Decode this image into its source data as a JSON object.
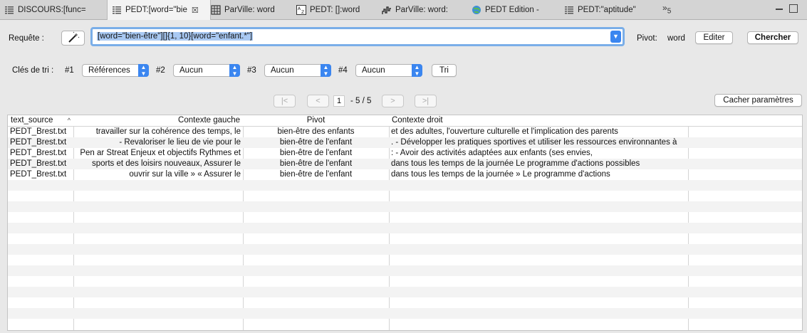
{
  "tabs": [
    {
      "label": "DISCOURS:[func=",
      "icon": "concordance-icon"
    },
    {
      "label": "PEDT:[word=\"bie",
      "icon": "concordance-icon",
      "active": true
    },
    {
      "label": "ParVille: word",
      "icon": "table-icon"
    },
    {
      "label": "PEDT: []:word",
      "icon": "lexicon-icon"
    },
    {
      "label": "ParVille: word:",
      "icon": "progression-chart-icon"
    },
    {
      "label": "PEDT Edition -",
      "icon": "globe-icon"
    },
    {
      "label": "PEDT:\"aptitude\"",
      "icon": "concordance-icon"
    }
  ],
  "tabs_overflow": {
    "symbol": "»",
    "count": "5"
  },
  "query": {
    "label": "Requête :",
    "value": "[word=\"bien-être\"][]{1, 10}[word=\"enfant.*\"]",
    "pivot_label": "Pivot:",
    "pivot_value": "word",
    "edit_label": "Editer",
    "search_label": "Chercher"
  },
  "sort": {
    "label": "Clés de tri :",
    "keys": [
      {
        "num": "#1",
        "value": "Références"
      },
      {
        "num": "#2",
        "value": "Aucun"
      },
      {
        "num": "#3",
        "value": "Aucun"
      },
      {
        "num": "#4",
        "value": "Aucun"
      }
    ],
    "sort_button": "Tri"
  },
  "pagination": {
    "first": "|<",
    "prev": "<",
    "page": "1",
    "range": "- 5 / 5",
    "next": ">",
    "last": ">|",
    "hide_params": "Cacher paramètres"
  },
  "table": {
    "columns": [
      "text_source",
      "Contexte gauche",
      "Pivot",
      "Contexte droit"
    ],
    "sort_indicator": "^",
    "rows": [
      [
        "PEDT_Brest.txt",
        "travailler sur la cohérence des temps, le",
        "bien-être des enfants",
        "et des adultes, l'ouverture culturelle et l'implication des parents"
      ],
      [
        "PEDT_Brest.txt",
        "- Revaloriser le lieu de vie pour le",
        "bien-être de l'enfant",
        ". - Développer les pratiques sportives et utiliser les ressources environnantes à"
      ],
      [
        "PEDT_Brest.txt",
        "Pen ar Streat Enjeux et objectifs Rythmes et",
        "bien-être de l'enfant",
        ": - Avoir des activités adaptées aux enfants (ses envies,"
      ],
      [
        "PEDT_Brest.txt",
        "sports et des loisirs nouveaux, Assurer le",
        "bien-être de l'enfant",
        "dans tous les temps de la journée Le programme d'actions possibles"
      ],
      [
        "PEDT_Brest.txt",
        "ouvrir sur la ville » « Assurer le",
        "bien-être de l'enfant",
        "dans tous les temps de la journée » Le programme d'actions"
      ]
    ]
  },
  "colors": {
    "accent": "#3b86f0",
    "selection": "#a9c9f3",
    "focus_ring": "#7aaee8"
  }
}
